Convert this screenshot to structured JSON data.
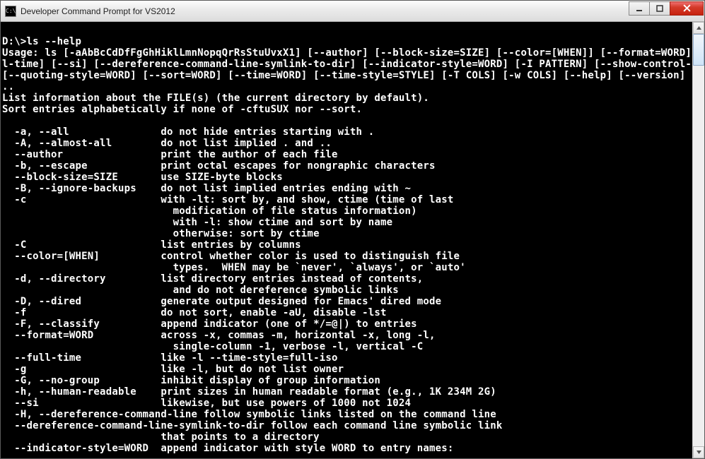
{
  "window": {
    "title": "Developer Command Prompt for VS2012",
    "icon_label": "C:\\"
  },
  "terminal": {
    "prompt": "D:\\>ls --help",
    "usage_lines": [
      "Usage: ls [-aAbBcCdDfFgGhHiklLmnNopqQrRsStuUvxX1] [--author] [--block-size=SIZE] [--color=[WHEN]] [--format=WORD] [--ful",
      "l-time] [--si] [--dereference-command-line-symlink-to-dir] [--indicator-style=WORD] [-I PATTERN] [--show-control-chars]",
      "[--quoting-style=WORD] [--sort=WORD] [--time=WORD] [--time-style=STYLE] [-T COLS] [-w COLS] [--help] [--version] [FILE].",
      ".."
    ],
    "description_lines": [
      "List information about the FILE(s) (the current directory by default).",
      "Sort entries alphabetically if none of -cftuSUX nor --sort."
    ],
    "options": [
      {
        "flag": "-a, --all",
        "desc": "do not hide entries starting with ."
      },
      {
        "flag": "-A, --almost-all",
        "desc": "do not list implied . and .."
      },
      {
        "flag": "--author",
        "desc": "print the author of each file"
      },
      {
        "flag": "-b, --escape",
        "desc": "print octal escapes for nongraphic characters"
      },
      {
        "flag": "--block-size=SIZE",
        "desc": "use SIZE-byte blocks"
      },
      {
        "flag": "-B, --ignore-backups",
        "desc": "do not list implied entries ending with ~"
      },
      {
        "flag": "-c",
        "desc": "with -lt: sort by, and show, ctime (time of last"
      },
      {
        "flag": "",
        "desc": "  modification of file status information)"
      },
      {
        "flag": "",
        "desc": "  with -l: show ctime and sort by name"
      },
      {
        "flag": "",
        "desc": "  otherwise: sort by ctime"
      },
      {
        "flag": "-C",
        "desc": "list entries by columns"
      },
      {
        "flag": "--color=[WHEN]",
        "desc": "control whether color is used to distinguish file"
      },
      {
        "flag": "",
        "desc": "  types.  WHEN may be `never', `always', or `auto'"
      },
      {
        "flag": "-d, --directory",
        "desc": "list directory entries instead of contents,"
      },
      {
        "flag": "",
        "desc": "  and do not dereference symbolic links"
      },
      {
        "flag": "-D, --dired",
        "desc": "generate output designed for Emacs' dired mode"
      },
      {
        "flag": "-f",
        "desc": "do not sort, enable -aU, disable -lst"
      },
      {
        "flag": "-F, --classify",
        "desc": "append indicator (one of */=@|) to entries"
      },
      {
        "flag": "--format=WORD",
        "desc": "across -x, commas -m, horizontal -x, long -l,"
      },
      {
        "flag": "",
        "desc": "  single-column -1, verbose -l, vertical -C"
      },
      {
        "flag": "--full-time",
        "desc": "like -l --time-style=full-iso"
      },
      {
        "flag": "-g",
        "desc": "like -l, but do not list owner"
      },
      {
        "flag": "-G, --no-group",
        "desc": "inhibit display of group information"
      },
      {
        "flag": "-h, --human-readable",
        "desc": "print sizes in human readable format (e.g., 1K 234M 2G)"
      },
      {
        "flag": "--si",
        "desc": "likewise, but use powers of 1000 not 1024"
      }
    ],
    "long_lines": [
      "  -H, --dereference-command-line follow symbolic links listed on the command line",
      "  --dereference-command-line-symlink-to-dir follow each command line symbolic link",
      "                          that points to a directory",
      "  --indicator-style=WORD  append indicator with style WORD to entry names:"
    ]
  }
}
